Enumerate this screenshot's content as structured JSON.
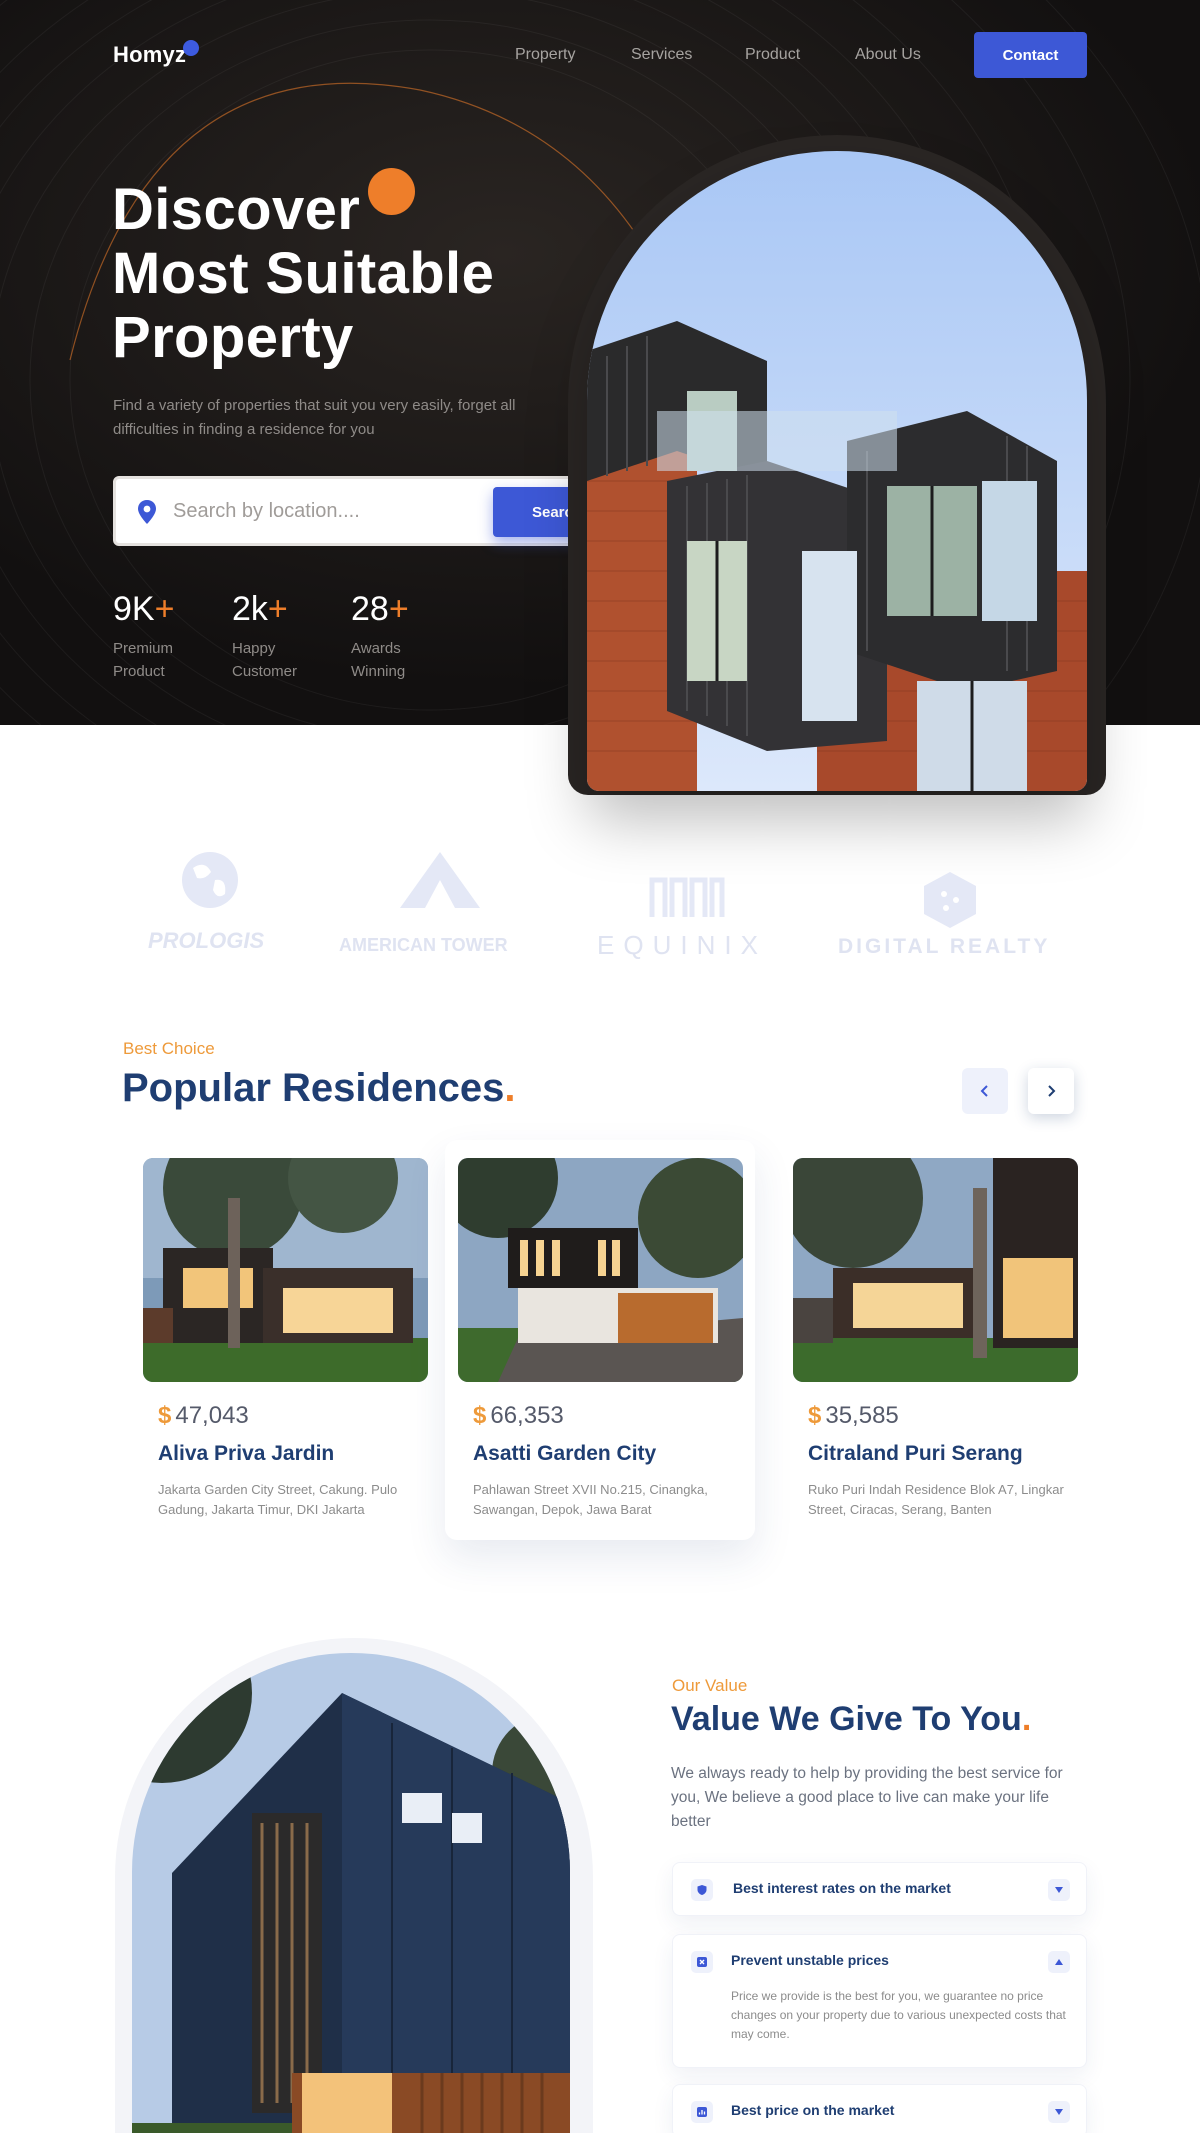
{
  "nav": {
    "logo": "Homyz",
    "links": [
      "Property",
      "Services",
      "Product",
      "About Us"
    ],
    "contact_label": "Contact"
  },
  "hero": {
    "title_lines": [
      "Discover",
      "Most Suitable",
      "Property"
    ],
    "subtitle": "Find a variety of properties that suit you very easily, forget all  difficulties in finding a residence for you",
    "search_placeholder": "Search by location....",
    "search_label": "Search",
    "stats": [
      {
        "value": "9K",
        "suffix": "+",
        "label": "Premium Product"
      },
      {
        "value": "2k",
        "suffix": "+",
        "label": "Happy Customer"
      },
      {
        "value": "28",
        "suffix": "+",
        "label": "Awards Winning"
      }
    ]
  },
  "companies": [
    "PROLOGIS",
    "AMERICAN TOWER",
    "EQUINIX",
    "DIGITAL REALTY"
  ],
  "residences": {
    "eyebrow": "Best Choice",
    "title": "Popular Residences",
    "title_dot": ".",
    "cards": [
      {
        "currency": "$",
        "price": "47,043",
        "name": "Aliva Priva Jardin",
        "address": "Jakarta  Garden City Street, Cakung. Pulo Gadung, Jakarta Timur, DKI Jakarta"
      },
      {
        "currency": "$",
        "price": "66,353",
        "name": "Asatti Garden City",
        "address": "Pahlawan Street XVII No.215, Cinangka, Sawangan, Depok, Jawa Barat"
      },
      {
        "currency": "$",
        "price": "35,585",
        "name": "Citraland Puri Serang",
        "address": "Ruko Puri Indah Residence Blok A7, Lingkar Street, Ciracas, Serang, Banten"
      }
    ]
  },
  "value": {
    "eyebrow": "Our Value",
    "title": "Value We Give To You",
    "title_dot": ".",
    "description": "We always ready to help by providing the best service for you, We believe a good place to live can make your life better",
    "accordion": [
      {
        "title": "Best interest rates on the market",
        "icon": "shield-icon",
        "expanded": false
      },
      {
        "title": "Prevent unstable prices",
        "icon": "cancel-box-icon",
        "expanded": true,
        "body": "Price we provide is the best for you, we guarantee no price changes on your property due to various unexpected costs that may come."
      },
      {
        "title": "Best price on the market",
        "icon": "analytics-icon",
        "expanded": false
      }
    ]
  },
  "colors": {
    "accent_blue": "#3d58d6",
    "accent_orange": "#ee7e2a",
    "navy": "#1f3e72",
    "hero_bg": "#131110"
  }
}
